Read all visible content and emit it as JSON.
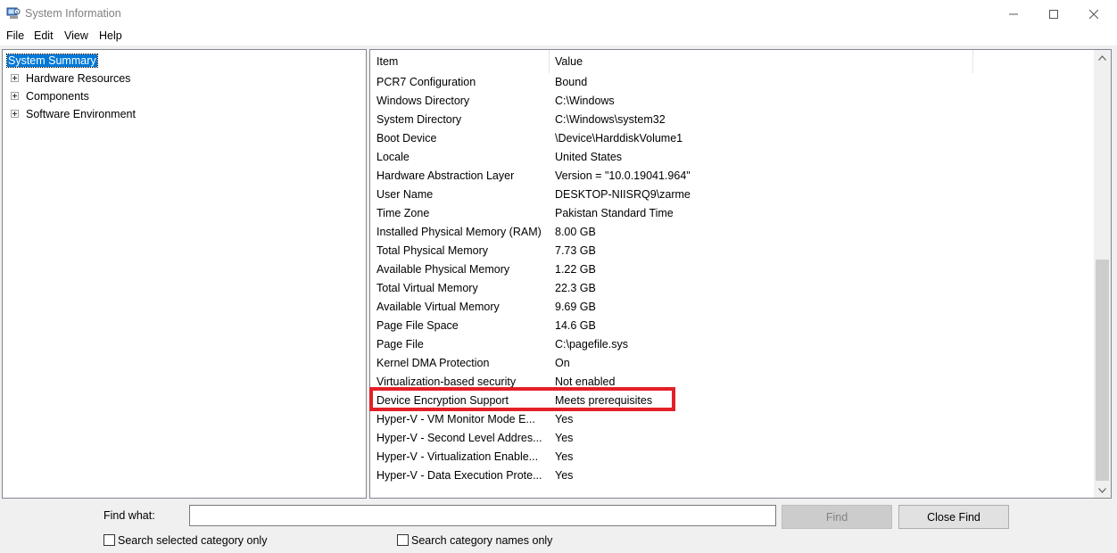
{
  "window": {
    "title": "System Information",
    "min_glyph": "─",
    "max_glyph": "☐",
    "close_glyph": "✕"
  },
  "menu": [
    "File",
    "Edit",
    "View",
    "Help"
  ],
  "tree": {
    "selected": "System Summary",
    "items": [
      "Hardware Resources",
      "Components",
      "Software Environment"
    ]
  },
  "list": {
    "headers": {
      "item": "Item",
      "value": "Value"
    },
    "rows": [
      {
        "item": "PCR7 Configuration",
        "value": "Bound"
      },
      {
        "item": "Windows Directory",
        "value": "C:\\Windows"
      },
      {
        "item": "System Directory",
        "value": "C:\\Windows\\system32"
      },
      {
        "item": "Boot Device",
        "value": "\\Device\\HarddiskVolume1"
      },
      {
        "item": "Locale",
        "value": "United States"
      },
      {
        "item": "Hardware Abstraction Layer",
        "value": "Version = \"10.0.19041.964\""
      },
      {
        "item": "User Name",
        "value": "DESKTOP-NIISRQ9\\zarme"
      },
      {
        "item": "Time Zone",
        "value": "Pakistan Standard Time"
      },
      {
        "item": "Installed Physical Memory (RAM)",
        "value": "8.00 GB"
      },
      {
        "item": "Total Physical Memory",
        "value": "7.73 GB"
      },
      {
        "item": "Available Physical Memory",
        "value": "1.22 GB"
      },
      {
        "item": "Total Virtual Memory",
        "value": "22.3 GB"
      },
      {
        "item": "Available Virtual Memory",
        "value": "9.69 GB"
      },
      {
        "item": "Page File Space",
        "value": "14.6 GB"
      },
      {
        "item": "Page File",
        "value": "C:\\pagefile.sys"
      },
      {
        "item": "Kernel DMA Protection",
        "value": "On"
      },
      {
        "item": "Virtualization-based security",
        "value": "Not enabled"
      },
      {
        "item": "Device Encryption Support",
        "value": "Meets prerequisites"
      },
      {
        "item": "Hyper-V - VM Monitor Mode E...",
        "value": "Yes"
      },
      {
        "item": "Hyper-V - Second Level Addres...",
        "value": "Yes"
      },
      {
        "item": "Hyper-V - Virtualization Enable...",
        "value": "Yes"
      },
      {
        "item": "Hyper-V - Data Execution Prote...",
        "value": "Yes"
      }
    ],
    "highlighted_item": "Device Encryption Support",
    "highlight_color": "#e32027"
  },
  "find": {
    "label": "Find what:",
    "input_value": "",
    "find_button": "Find",
    "close_button": "Close Find",
    "check_selected": "Search selected category only",
    "check_names": "Search category names only"
  },
  "colors": {
    "selection": "#0078d7",
    "pane_border": "#828790"
  }
}
